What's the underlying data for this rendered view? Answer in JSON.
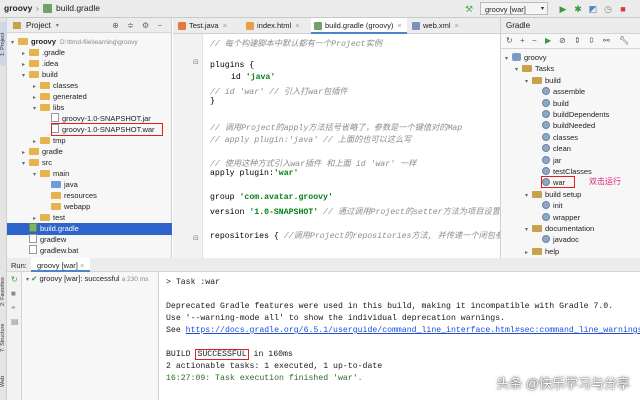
{
  "titlebar": {
    "project": "groovy",
    "file": "build.gradle",
    "run_config": "groovy [war]"
  },
  "left_stripe": {
    "top_tab": "1: Project",
    "bottom_tabs": [
      "2: Favorites",
      "7: Structure",
      "Web"
    ]
  },
  "project_panel": {
    "title": "Project",
    "tree": [
      {
        "label": "groovy",
        "extra": "D:\\ttmd-file\\learning\\groovy",
        "indent": 0,
        "arrow": "▾",
        "icon": "folder"
      },
      {
        "label": ".gradle",
        "indent": 1,
        "arrow": "▸",
        "icon": "folder"
      },
      {
        "label": ".idea",
        "indent": 1,
        "arrow": "▸",
        "icon": "folder"
      },
      {
        "label": "build",
        "indent": 1,
        "arrow": "▾",
        "icon": "folder"
      },
      {
        "label": "classes",
        "indent": 2,
        "arrow": "▸",
        "icon": "folder"
      },
      {
        "label": "generated",
        "indent": 2,
        "arrow": "▸",
        "icon": "folder"
      },
      {
        "label": "libs",
        "indent": 2,
        "arrow": "▾",
        "icon": "folder"
      },
      {
        "label": "groovy-1.0-SNAPSHOT.jar",
        "indent": 3,
        "arrow": "",
        "icon": "file"
      },
      {
        "label": "groovy-1.0-SNAPSHOT.war",
        "indent": 3,
        "arrow": "",
        "icon": "file"
      },
      {
        "label": "tmp",
        "indent": 2,
        "arrow": "▸",
        "icon": "folder"
      },
      {
        "label": "gradle",
        "indent": 1,
        "arrow": "▸",
        "icon": "folder"
      },
      {
        "label": "src",
        "indent": 1,
        "arrow": "▾",
        "icon": "folder"
      },
      {
        "label": "main",
        "indent": 2,
        "arrow": "▾",
        "icon": "folder"
      },
      {
        "label": "java",
        "indent": 3,
        "arrow": "",
        "icon": "folder-blue"
      },
      {
        "label": "resources",
        "indent": 3,
        "arrow": "",
        "icon": "folder"
      },
      {
        "label": "webapp",
        "indent": 3,
        "arrow": "",
        "icon": "folder"
      },
      {
        "label": "test",
        "indent": 2,
        "arrow": "▸",
        "icon": "folder"
      },
      {
        "label": "build.gradle",
        "indent": 1,
        "arrow": "",
        "icon": "gradle",
        "selected": true
      },
      {
        "label": "gradlew",
        "indent": 1,
        "arrow": "",
        "icon": "file"
      },
      {
        "label": "gradlew.bat",
        "indent": 1,
        "arrow": "",
        "icon": "file"
      }
    ]
  },
  "editor_tabs": [
    {
      "label": "Test.java",
      "color": "#e27a3f"
    },
    {
      "label": "index.html",
      "color": "#e5a04b"
    },
    {
      "label": "build.gradle (groovy)",
      "color": "#6fa16a",
      "active": true
    },
    {
      "label": "web.xml",
      "color": "#7a8fbf"
    }
  ],
  "code": {
    "line1": "// 每个构建脚本中默认都有一个Project实例",
    "plugins_open": "plugins {",
    "id_kw": "id",
    "id_val": "'java'",
    "war_line": "//    id 'war' // 引入打war包插件",
    "plugins_close": "}",
    "cm_apply1": "// 调用Project的apply方法括号省略了，参数是一个键值对的Map",
    "cm_apply2": "// apply plugin:'java' // 上面的也可以这么写",
    "cm_apply3": "// 使用这种方式引入war插件  和上面 id 'war' 一样",
    "apply_kw": "apply plugin:",
    "apply_val": "'war'",
    "group_kw": "group",
    "group_val": "'com.avatar.groovy'",
    "version_kw": "version",
    "version_val": "'1.0-SNAPSHOT'",
    "version_cm": "// 通过调用Project的setter方法为项目设置",
    "repos": "repositories {",
    "repos_cm": "//调用Project的repositories方法, 并传递一个闭包参"
  },
  "gradle_panel": {
    "title": "Gradle",
    "tree": [
      {
        "label": "groovy",
        "indent": 0,
        "arrow": "▾",
        "icon": "elephant"
      },
      {
        "label": "Tasks",
        "indent": 1,
        "arrow": "▾",
        "icon": "folder"
      },
      {
        "label": "build",
        "indent": 2,
        "arrow": "▾",
        "icon": "folder"
      },
      {
        "label": "assemble",
        "indent": 3,
        "arrow": "",
        "icon": "gear"
      },
      {
        "label": "build",
        "indent": 3,
        "arrow": "",
        "icon": "gear"
      },
      {
        "label": "buildDependents",
        "indent": 3,
        "arrow": "",
        "icon": "gear"
      },
      {
        "label": "buildNeeded",
        "indent": 3,
        "arrow": "",
        "icon": "gear"
      },
      {
        "label": "classes",
        "indent": 3,
        "arrow": "",
        "icon": "gear"
      },
      {
        "label": "clean",
        "indent": 3,
        "arrow": "",
        "icon": "gear"
      },
      {
        "label": "jar",
        "indent": 3,
        "arrow": "",
        "icon": "gear"
      },
      {
        "label": "testClasses",
        "indent": 3,
        "arrow": "",
        "icon": "gear"
      },
      {
        "label": "war",
        "indent": 3,
        "arrow": "",
        "icon": "gear"
      },
      {
        "label": "build setup",
        "indent": 2,
        "arrow": "▾",
        "icon": "folder"
      },
      {
        "label": "init",
        "indent": 3,
        "arrow": "",
        "icon": "gear"
      },
      {
        "label": "wrapper",
        "indent": 3,
        "arrow": "",
        "icon": "gear"
      },
      {
        "label": "documentation",
        "indent": 2,
        "arrow": "▾",
        "icon": "folder"
      },
      {
        "label": "javadoc",
        "indent": 3,
        "arrow": "",
        "icon": "gear"
      },
      {
        "label": "help",
        "indent": 2,
        "arrow": "▸",
        "icon": "folder"
      }
    ],
    "annotation": "双击运行",
    "annotation_color": "#e0207a"
  },
  "run_panel": {
    "label": "Run:",
    "tab": "groovy [war]",
    "result_text": "groovy [war]: successful",
    "result_time": "a 230 ms"
  },
  "console": {
    "task": "> Task :war",
    "deprecated1": "Deprecated Gradle features were used in this build, making it incompatible with Gradle 7.0.",
    "deprecated2": "Use '--warning-mode all' to show the individual deprecation warnings.",
    "see": "See ",
    "see_link": "https://docs.gradle.org/6.5.1/userguide/command_line_interface.html#sec:command_line_warnings",
    "build": "BUILD ",
    "successful": "SUCCESSFUL",
    "build_time": " in 160ms",
    "tasks": "2 actionable tasks: 1 executed, 1 up-to-date",
    "finished": "16:27:09: Task execution finished 'war'."
  },
  "watermark": "头条 @快乐学习与分享"
}
